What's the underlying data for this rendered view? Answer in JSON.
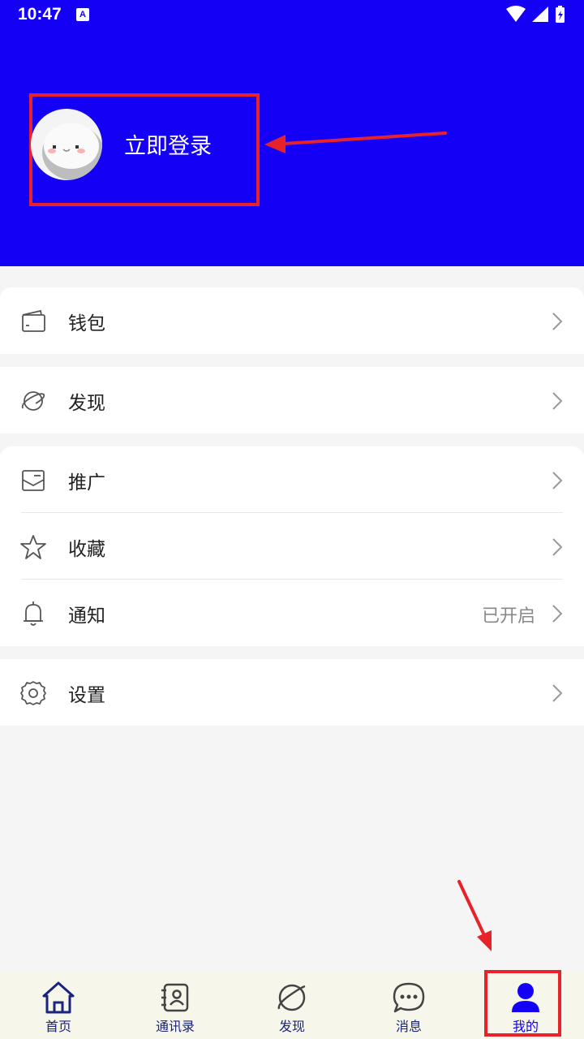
{
  "status_bar": {
    "time": "10:47",
    "badge": "A"
  },
  "profile": {
    "login_label": "立即登录"
  },
  "menu": {
    "wallet": "钱包",
    "discover": "发现",
    "promote": "推广",
    "favorites": "收藏",
    "notifications": "通知",
    "notifications_status": "已开启",
    "settings": "设置"
  },
  "tabs": [
    {
      "label": "首页",
      "icon": "home-icon"
    },
    {
      "label": "通讯录",
      "icon": "contacts-icon"
    },
    {
      "label": "发现",
      "icon": "discover-icon"
    },
    {
      "label": "消息",
      "icon": "message-icon"
    },
    {
      "label": "我的",
      "icon": "profile-icon"
    }
  ],
  "colors": {
    "header": "#1400f5",
    "annotation": "#e8222a",
    "tab_active": "#1400f5",
    "tab_inactive": "#1a237e",
    "tabbar_bg": "#f6f6ea"
  }
}
